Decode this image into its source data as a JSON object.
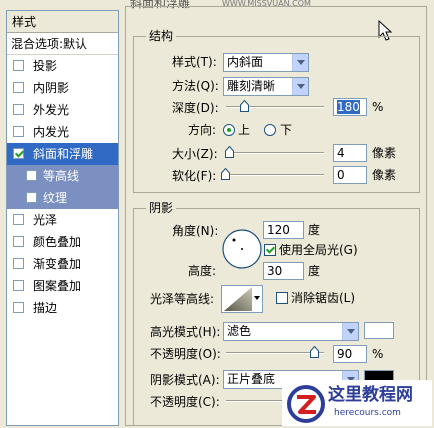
{
  "style_list": {
    "header": "样式",
    "blend_options": "混合选项:默认",
    "items": [
      {
        "label": "投影",
        "checked": false
      },
      {
        "label": "内阴影",
        "checked": false
      },
      {
        "label": "外发光",
        "checked": false
      },
      {
        "label": "内发光",
        "checked": false
      },
      {
        "label": "斜面和浮雕",
        "checked": true
      },
      {
        "label": "等高线",
        "checked": false
      },
      {
        "label": "纹理",
        "checked": false
      },
      {
        "label": "光泽",
        "checked": false
      },
      {
        "label": "颜色叠加",
        "checked": false
      },
      {
        "label": "渐变叠加",
        "checked": false
      },
      {
        "label": "图案叠加",
        "checked": false
      },
      {
        "label": "描边",
        "checked": false
      }
    ]
  },
  "bevel": {
    "section_title": "斜面和浮雕",
    "structure_title": "结构",
    "style_label": "样式(T):",
    "style_value": "内斜面",
    "technique_label": "方法(Q):",
    "technique_value": "雕刻清晰",
    "depth_label": "深度(D):",
    "depth_value": "180",
    "depth_unit": "%",
    "depth_slider": 0.18,
    "direction_label": "方向:",
    "direction_up": "上",
    "direction_down": "下",
    "direction_selected": "上",
    "size_label": "大小(Z):",
    "size_value": "4",
    "size_unit": "像素",
    "soften_label": "软化(F):",
    "soften_value": "0",
    "soften_unit": "像素"
  },
  "shading": {
    "title": "阴影",
    "angle_label": "角度(N):",
    "angle_value": "120",
    "angle_unit": "度",
    "global_light_label": "使用全局光(G)",
    "global_light_checked": true,
    "altitude_label": "高度:",
    "altitude_value": "30",
    "altitude_unit": "度",
    "gloss_label": "光泽等高线:",
    "antialias_label": "消除锯齿(L)",
    "antialias_checked": false,
    "highlight_label": "高光模式(H):",
    "highlight_mode": "滤色",
    "highlight_color": "#ffffff",
    "highlight_opacity_label": "不透明度(O):",
    "highlight_opacity": "90",
    "highlight_opacity_unit": "%",
    "highlight_slider": 0.9,
    "shadow_label": "阴影模式(A):",
    "shadow_mode": "正片叠底",
    "shadow_color": "#000000",
    "shadow_opacity_label": "不透明度(C):"
  },
  "watermark": {
    "text": "这里教程网",
    "url": "herecours.com",
    "top_url": "WWW.MISSVUAN.COM"
  }
}
